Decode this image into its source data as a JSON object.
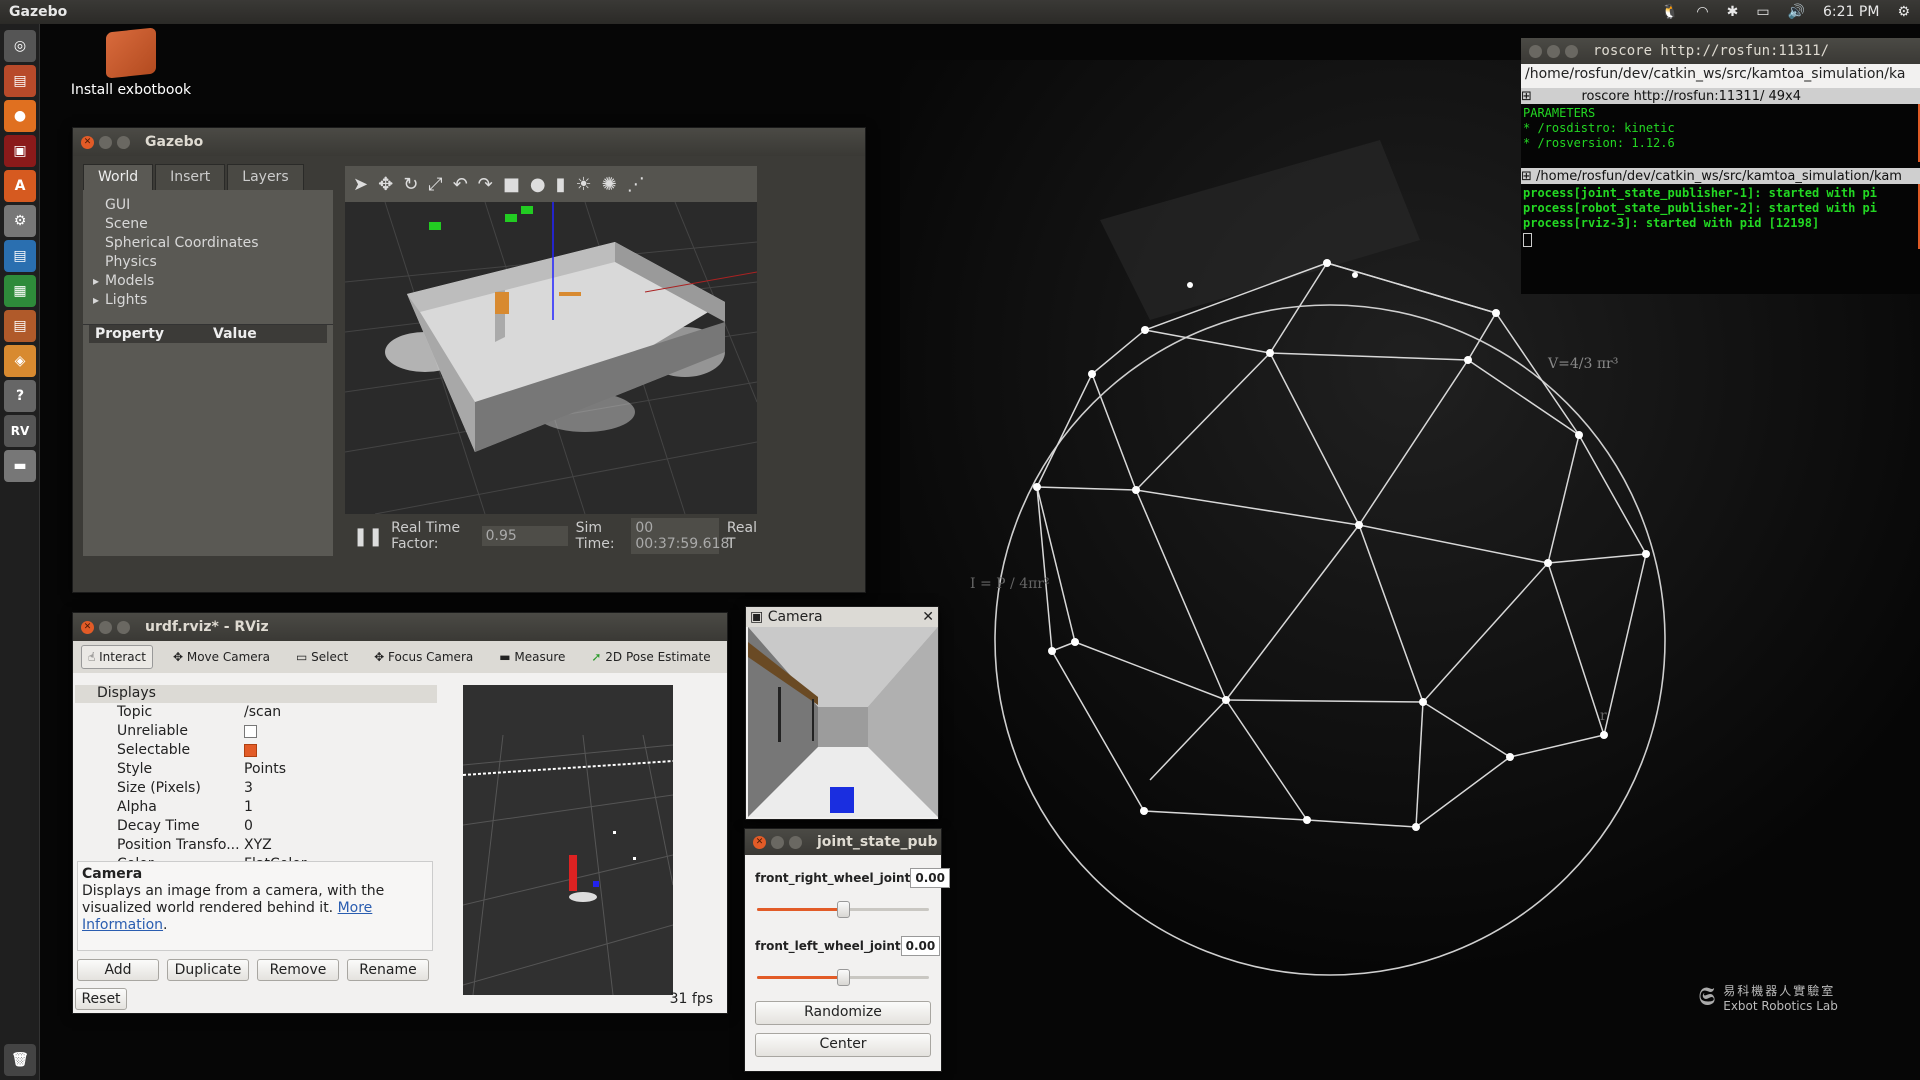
{
  "topbar": {
    "app_title": "Gazebo",
    "time": "6:21 PM"
  },
  "desktop": {
    "icon_label": "Install exbotbook"
  },
  "gazebo": {
    "title": "Gazebo",
    "tabs": [
      "World",
      "Insert",
      "Layers"
    ],
    "tree": [
      "GUI",
      "Scene",
      "Spherical Coordinates",
      "Physics",
      "Models",
      "Lights"
    ],
    "prop_header": {
      "property": "Property",
      "value": "Value"
    },
    "status": {
      "rtf_label": "Real Time Factor:",
      "rtf_value": "0.95",
      "sim_label": "Sim Time:",
      "sim_value": "00 00:37:59.618",
      "real_label": "Real T"
    }
  },
  "rviz": {
    "title": "urdf.rviz* - RViz",
    "tools": [
      "Interact",
      "Move Camera",
      "Select",
      "Focus Camera",
      "Measure",
      "2D Pose Estimate"
    ],
    "displays_title": "Displays",
    "props": [
      {
        "k": "Topic",
        "v": "/scan"
      },
      {
        "k": "Unreliable",
        "v": ""
      },
      {
        "k": "Selectable",
        "v": ""
      },
      {
        "k": "Style",
        "v": "Points"
      },
      {
        "k": "Size (Pixels)",
        "v": "3"
      },
      {
        "k": "Alpha",
        "v": "1"
      },
      {
        "k": "Decay Time",
        "v": "0"
      },
      {
        "k": "Position Transfo...",
        "v": "XYZ"
      },
      {
        "k": "Color Transformer",
        "v": "FlatColor"
      }
    ],
    "desc_title": "Camera",
    "desc_text": "Displays an image from a camera, with the visualized world rendered behind it.",
    "desc_link1": "More",
    "desc_link2": "Information",
    "desc_end": ".",
    "buttons": [
      "Add",
      "Duplicate",
      "Remove",
      "Rename"
    ],
    "reset": "Reset",
    "fps": "31 fps"
  },
  "camera": {
    "title": "Camera"
  },
  "jsp": {
    "title": "joint_state_pub",
    "joints": [
      {
        "name": "front_right_wheel_joint",
        "value": "0.00",
        "level": 0.5
      },
      {
        "name": "front_left_wheel_joint",
        "value": "0.00",
        "level": 0.5
      }
    ],
    "randomize": "Randomize",
    "center": "Center"
  },
  "terminal": {
    "title": "roscore http://rosfun:11311/",
    "path": "/home/rosfun/dev/catkin_ws/src/kamtoa_simulation/ka",
    "pane1": "roscore http://rosfun:11311/ 49x4",
    "lines1": [
      "PARAMETERS",
      " * /rosdistro: kinetic",
      " * /rosversion: 1.12.6"
    ],
    "pane2": "/home/rosfun/dev/catkin_ws/src/kamtoa_simulation/kam",
    "lines2": [
      "process[joint_state_publisher-1]: started with pi",
      "process[robot_state_publisher-2]: started with pi",
      "process[rviz-3]: started with pid [12198]"
    ]
  },
  "wallpaper": {
    "formula1": "V=4/3 πr³",
    "formula2": "I = P / 4πr²",
    "formula3": "r",
    "brand_cn": "易科機器人實驗室",
    "brand_en": "Exbot Robotics Lab"
  },
  "colors": {
    "accent": "#e25b27",
    "terminal_green": "#23d823"
  }
}
